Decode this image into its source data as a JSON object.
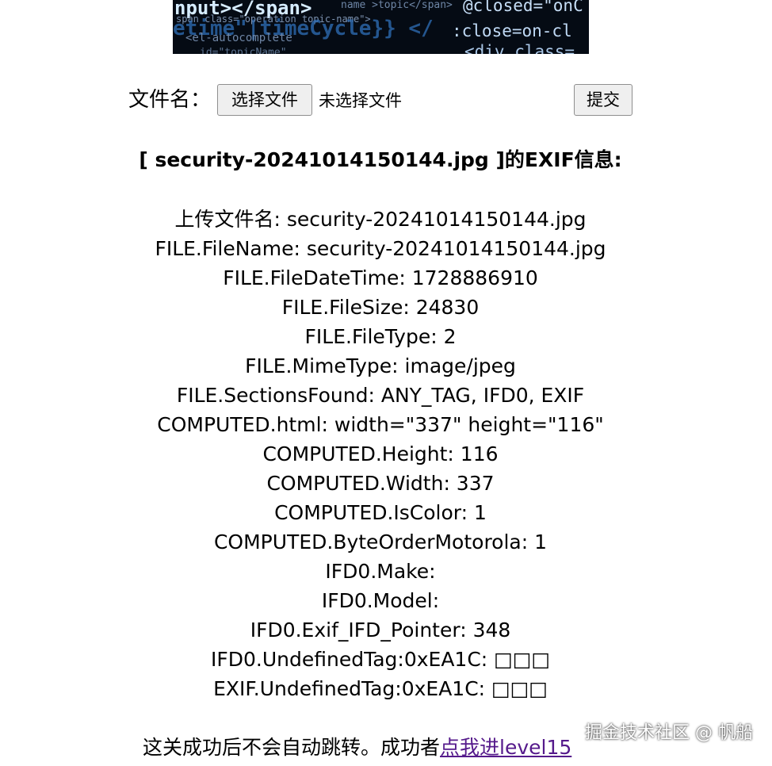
{
  "banner": {
    "code_lines": [
      "nput></span>",
      "name >topic</span>",
      "@closed=\"onC",
      "span class=\"operation topic-name\">",
      "etime\"|timeCycle}} </",
      ":close=on-cl",
      "<el-autocomplete",
      "id=\"topicName\"",
      "<div class="
    ]
  },
  "upload": {
    "label": "文件名：",
    "choose_button": "选择文件",
    "no_file_text": "未选择文件",
    "submit_button": "提交"
  },
  "exif": {
    "title": "[ security-20241014150144.jpg ]的EXIF信息:",
    "items": [
      "上传文件名: security-20241014150144.jpg",
      "FILE.FileName: security-20241014150144.jpg",
      "FILE.FileDateTime: 1728886910",
      "FILE.FileSize: 24830",
      "FILE.FileType: 2",
      "FILE.MimeType: image/jpeg",
      "FILE.SectionsFound: ANY_TAG, IFD0, EXIF",
      "COMPUTED.html: width=\"337\" height=\"116\"",
      "COMPUTED.Height: 116",
      "COMPUTED.Width: 337",
      "COMPUTED.IsColor: 1",
      "COMPUTED.ByteOrderMotorola: 1",
      "IFD0.Make:",
      "IFD0.Model:",
      "IFD0.Exif_IFD_Pointer: 348",
      "IFD0.UndefinedTag:0xEA1C: □□□",
      "EXIF.UndefinedTag:0xEA1C: □□□"
    ]
  },
  "footer": {
    "text": "这关成功后不会自动跳转。成功者",
    "link_text": "点我进level15"
  },
  "watermark": {
    "text": "掘金技术社区 @ 帆船"
  }
}
